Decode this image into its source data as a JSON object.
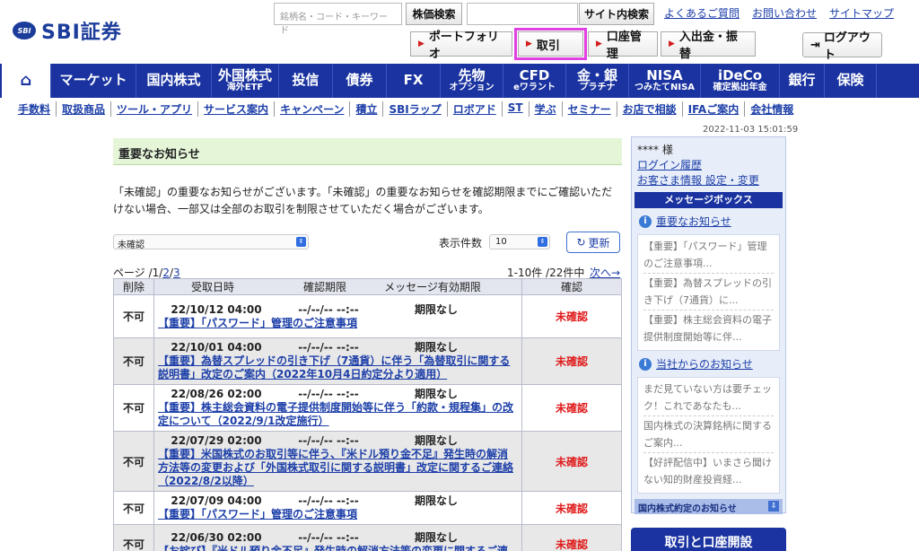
{
  "header": {
    "logo_badge": "SBI",
    "logo_text": "SBI証券",
    "stock_search_placeholder": "銘柄名・コード・キーワード",
    "stock_search_button": "株価検索",
    "site_search_button": "サイト内検索",
    "top_links": [
      "よくあるご質問",
      "お問い合わせ",
      "サイトマップ"
    ],
    "nav_buttons": [
      "ポートフォリオ",
      "取引",
      "口座管理",
      "入出金・振替"
    ],
    "logout": "ログアウト"
  },
  "navbar": {
    "home_icon": "home-icon",
    "items": [
      {
        "label": "マーケット",
        "sub": ""
      },
      {
        "label": "国内株式",
        "sub": ""
      },
      {
        "label": "外国株式",
        "sub": "海外ETF"
      },
      {
        "label": "投信",
        "sub": ""
      },
      {
        "label": "債券",
        "sub": ""
      },
      {
        "label": "FX",
        "sub": ""
      },
      {
        "label": "先物",
        "sub": "オプション"
      },
      {
        "label": "CFD",
        "sub": "eワラント"
      },
      {
        "label": "金・銀",
        "sub": "プラチナ"
      },
      {
        "label": "NISA",
        "sub": "つみたてNISA"
      },
      {
        "label": "iDeCo",
        "sub": "確定拠出年金"
      },
      {
        "label": "銀行",
        "sub": ""
      },
      {
        "label": "保険",
        "sub": ""
      }
    ]
  },
  "subnav": [
    "手数料",
    "取扱商品",
    "ツール・アプリ",
    "サービス案内",
    "キャンペーン",
    "積立",
    "SBIラップ",
    "ロボアド",
    "ST",
    "学ぶ",
    "セミナー",
    "お店で相談",
    "IFAご案内",
    "会社情報"
  ],
  "timestamp": "2022-11-03 15:01:59",
  "main": {
    "title": "重要なお知らせ",
    "notice": "「未確認」の重要なお知らせがございます。「未確認」の重要なお知らせを確認期限までにご確認いただけない場合、一部又は全部のお取引を制限させていただく場合がございます。",
    "filter_value": "未確認",
    "count_label": "表示件数",
    "count_value": "10",
    "refresh": "更新",
    "pager_prefix": "ページ /",
    "pager_current": "1",
    "pager_pages": [
      "2",
      "3"
    ],
    "range": "1-10件 /22件中",
    "next": "次へ→",
    "columns": [
      "削除",
      "受取日時",
      "確認期限",
      "メッセージ有効期限",
      "確認"
    ],
    "rows": [
      {
        "del": "不可",
        "date": "22/10/12 04:00",
        "deadline": "--/--/-- --:--",
        "expiry": "期限なし",
        "subject": "【重要】「パスワード」管理のご注意事項",
        "status": "未確認"
      },
      {
        "del": "不可",
        "date": "22/10/01 04:00",
        "deadline": "--/--/-- --:--",
        "expiry": "期限なし",
        "subject": "【重要】為替スプレッドの引き下げ（7通貨）に伴う「為替取引に関する説明書」改定のご案内（2022年10月4日約定分より適用）",
        "status": "未確認"
      },
      {
        "del": "不可",
        "date": "22/08/26 02:00",
        "deadline": "--/--/-- --:--",
        "expiry": "期限なし",
        "subject": "【重要】株主総会資料の電子提供制度開始等に伴う「約款・規程集」の改定について（2022/9/1改定施行）",
        "status": "未確認"
      },
      {
        "del": "不可",
        "date": "22/07/29 02:00",
        "deadline": "--/--/-- --:--",
        "expiry": "期限なし",
        "subject": "【重要】米国株式のお取引等に伴う、『米ドル預り金不足』発生時の解消方法等の変更および「外国株式取引に関する説明書」改定に関するご連絡（2022/8/2以降）",
        "status": "未確認"
      },
      {
        "del": "不可",
        "date": "22/07/09 04:00",
        "deadline": "--/--/-- --:--",
        "expiry": "期限なし",
        "subject": "【重要】「パスワード」管理のご注意事項",
        "status": "未確認"
      },
      {
        "del": "不可",
        "date": "22/06/30 02:00",
        "deadline": "--/--/-- --:--",
        "expiry": "期限なし",
        "subject": "【お詫び】『米ドル預り金不足』発生時の解消方法等の変更に関するご連",
        "status": "未確認"
      }
    ]
  },
  "sidebar": {
    "user": "**** 様",
    "login_history": "ログイン履歴",
    "settings": "お客さま情報 設定・変更",
    "message_box": "メッセージボックス",
    "important_title": "重要なお知らせ",
    "important_items": [
      "【重要】「パスワード」管理のご注意事項...",
      "【重要】為替スプレッドの引き下げ（7通貨）に...",
      "【重要】株主総会資料の電子提供制度開始等に伴..."
    ],
    "company_title": "当社からのお知らせ",
    "company_items": [
      "まだ見ていない方は要チェック！これであなたも...",
      "国内株式の決算銘柄に関するご案内...",
      "【好評配信中】いまさら聞けない知的財産投資経..."
    ],
    "domestic_bar": "国内株式約定のお知らせ",
    "open_account": "取引と口座開設"
  }
}
